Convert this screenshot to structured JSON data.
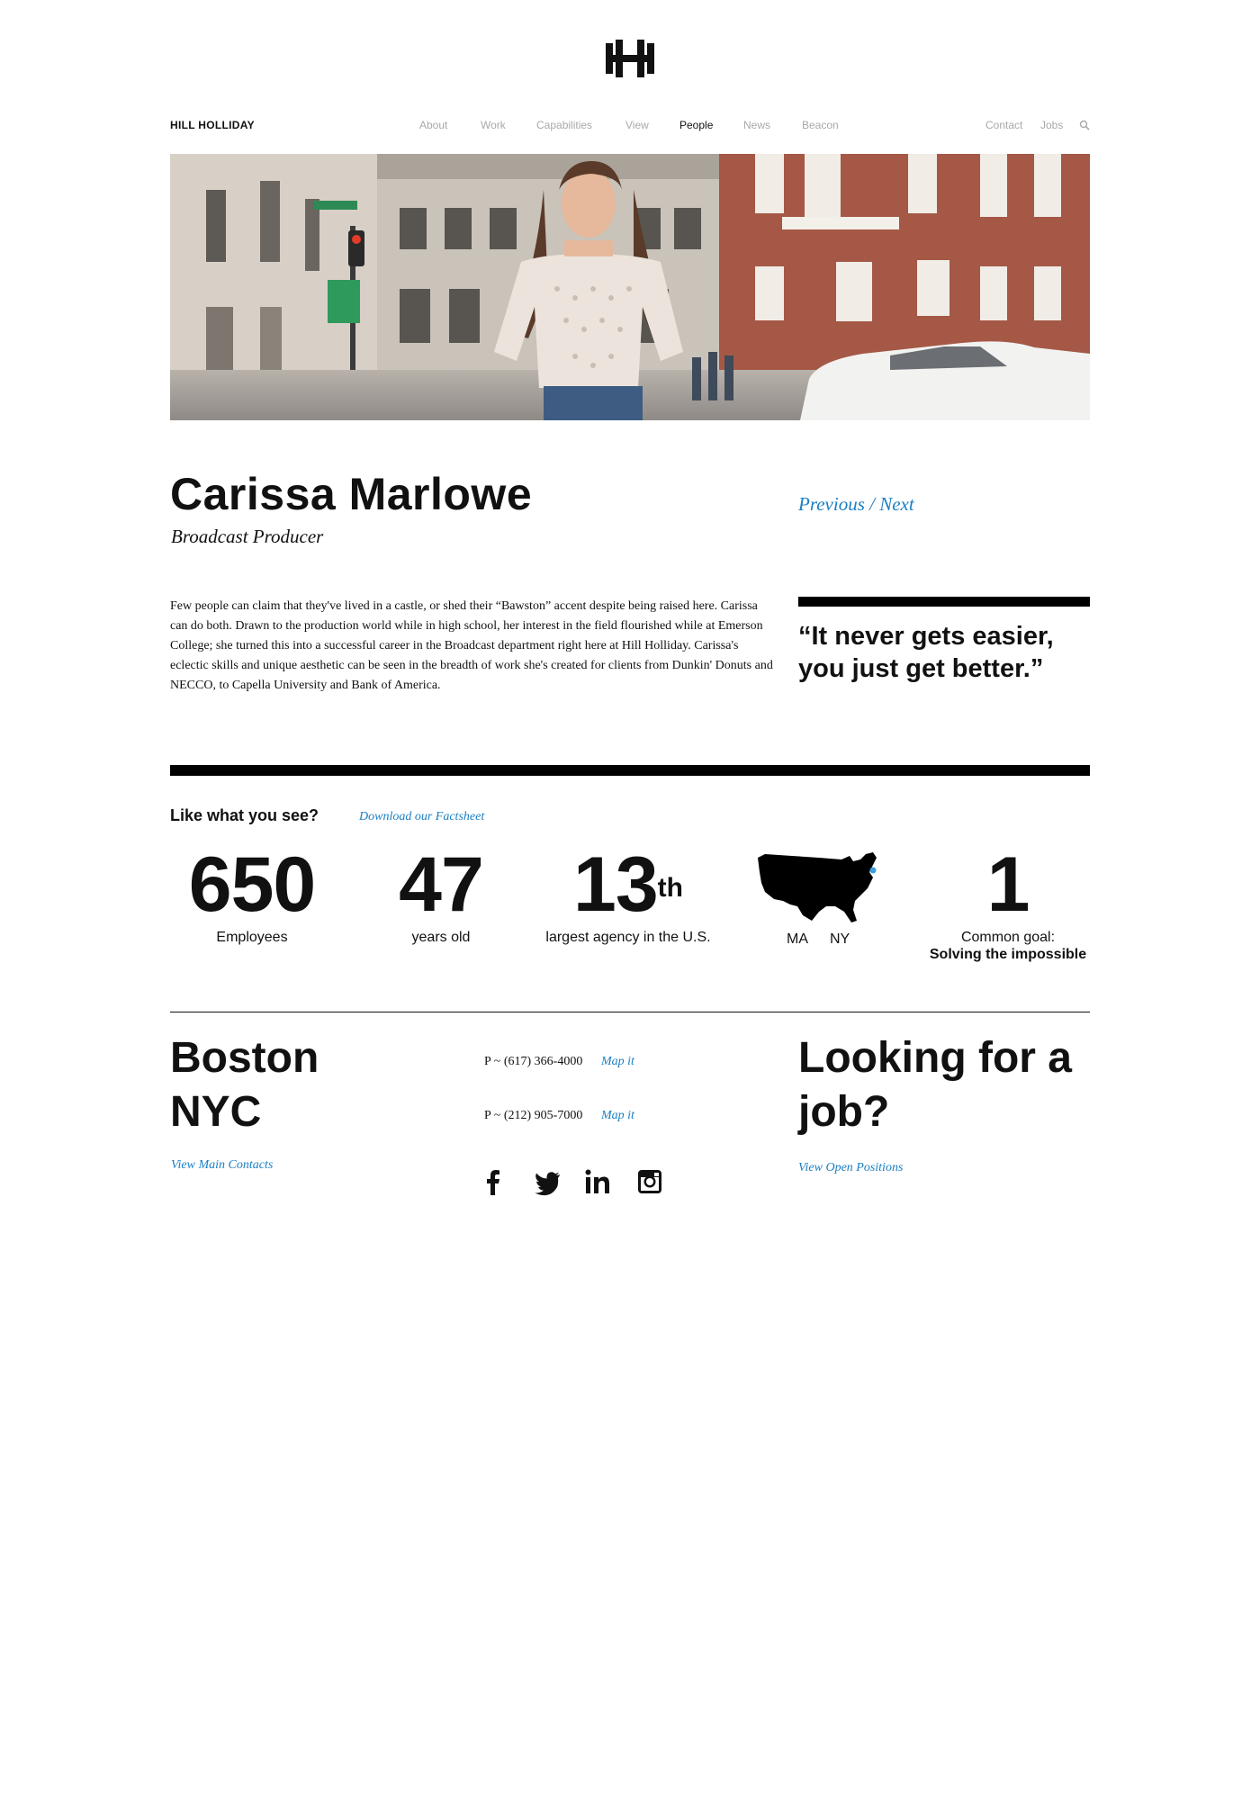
{
  "header": {
    "brand": "HILL HOLLIDAY",
    "nav": [
      {
        "label": "About",
        "active": false
      },
      {
        "label": "Work",
        "active": false
      },
      {
        "label": "Capabilities",
        "active": false
      },
      {
        "label": "View",
        "active": false
      },
      {
        "label": "People",
        "active": true
      },
      {
        "label": "News",
        "active": false
      },
      {
        "label": "Beacon",
        "active": false
      }
    ],
    "utility": [
      {
        "label": "Contact"
      },
      {
        "label": "Jobs"
      }
    ],
    "search_icon": "search-icon"
  },
  "profile": {
    "name": "Carissa Marlowe",
    "title": "Broadcast Producer",
    "prev_label": "Previous",
    "separator": "/",
    "next_label": "Next",
    "bio": "Few people can claim that they've lived in a castle, or shed their “Bawston” accent despite being raised here. Carissa can do both. Drawn to the production world while in high school, her interest in the field flourished while at Emerson College; she turned this into a successful career in the Broadcast department right here at Hill Holliday. Carissa's eclectic skills and unique aesthetic can be seen in the breadth of work she's created for clients from Dunkin' Donuts and NECCO, to Capella University and Bank of America.",
    "quote": "“It never gets easier, you just get better.”"
  },
  "stats": {
    "like_label": "Like what you see?",
    "factsheet_label": "Download our Factsheet",
    "employees_num": "650",
    "employees_label": "Employees",
    "age_num": "47",
    "age_label": "years old",
    "rank_num": "13",
    "rank_suffix": "th",
    "rank_label": "largest agency in the U.S.",
    "map_label_ma": "MA",
    "map_label_ny": "NY",
    "goal_num": "1",
    "goal_label": "Common goal:",
    "goal_label2": "Solving the impossible"
  },
  "footer": {
    "city1": "Boston",
    "city2": "NYC",
    "contacts_link": "View Main Contacts",
    "phone1": "P ~ (617) 366-4000",
    "phone2": "P ~ (212) 905-7000",
    "mapit": "Map it",
    "social": [
      "facebook-icon",
      "twitter-icon",
      "linkedin-icon",
      "instagram-icon"
    ],
    "job_heading": "Looking for a job?",
    "positions_link": "View Open Positions"
  },
  "colors": {
    "accent": "#1a7fc4",
    "nav_inactive": "#a9a9a9",
    "text": "#111111"
  }
}
